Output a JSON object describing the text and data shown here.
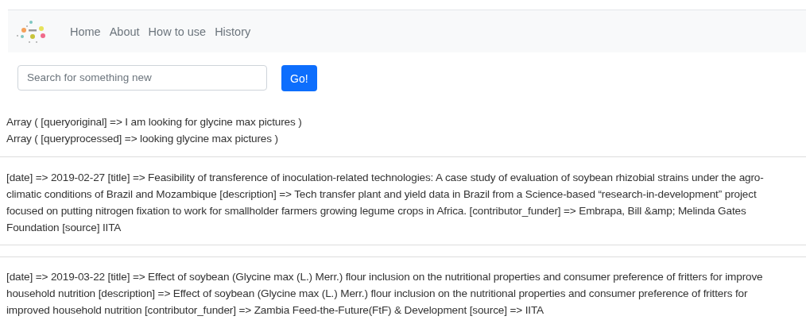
{
  "navbar": {
    "links": [
      "Home",
      "About",
      "How to use",
      "History"
    ]
  },
  "search": {
    "placeholder": "Search for something new",
    "button": "Go!"
  },
  "query_lines": [
    "Array ( [queryoriginal] => I am looking for glycine max pictures )",
    "Array ( [queryprocessed] => looking glycine max pictures )"
  ],
  "results": [
    {
      "lines": [
        "[date] => 2019-02-27 [title] => Feasibility of transference of inoculation-related technologies: A case study of evaluation of soybean rhizobial strains under the agro-",
        "climatic conditions of Brazil and Mozambique [description] => Tech transfer plant and yield data in Brazil from a Science-based “research-in-development” project",
        "focused on putting nitrogen fixation to work for smallholder farmers growing legume crops in Africa. [contributor_funder] => Embrapa, Bill &amp; Melinda Gates",
        "Foundation [source] IITA"
      ]
    },
    {
      "lines": [
        "[date] => 2019-03-22 [title] => Effect of soybean (Glycine max (L.) Merr.) flour inclusion on the nutritional properties and consumer preference of fritters for improve",
        "household nutrition [description] => Effect of soybean (Glycine max (L.) Merr.) flour inclusion on the nutritional properties and consumer preference of fritters for",
        "improved household nutrition [contributor_funder] => Zambia Feed-the-Future(FtF) & Development [source] => IITA"
      ]
    }
  ]
}
